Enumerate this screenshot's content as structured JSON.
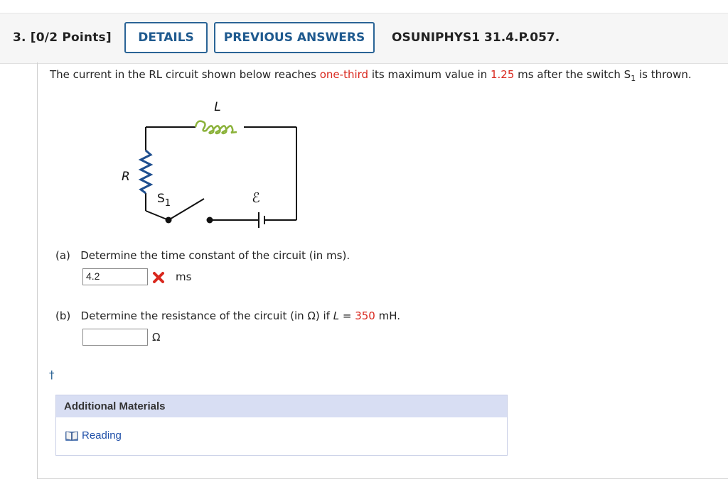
{
  "header": {
    "question_label": "3.  [0/2 Points]",
    "details_button": "DETAILS",
    "previous_answers_button": "PREVIOUS ANSWERS",
    "course_code": "OSUNIPHYS1 31.4.P.057."
  },
  "question": {
    "text_1": "The current in the RL circuit shown below reaches ",
    "fraction_highlight": "one-third",
    "text_2": " its maximum value in ",
    "time_value": "1.25",
    "text_3": " ms after the switch S",
    "switch_sub": "1",
    "text_4": " is thrown."
  },
  "circuit": {
    "inductor_label": "L",
    "resistor_label": "R",
    "switch_label": "S",
    "switch_sub": "1",
    "emf_label": "ℰ",
    "inductor_color": "#8bb23a",
    "resistor_color": "#1f4f8f"
  },
  "part_a": {
    "letter": "(a)",
    "prompt": "Determine the time constant of the circuit (in ms).",
    "answer_value": "4.2",
    "status": "incorrect",
    "status_icon": "x-icon",
    "unit": "ms"
  },
  "part_b": {
    "letter": "(b)",
    "prompt_1": "Determine the resistance of the circuit (in Ω) if ",
    "prompt_var": "L",
    "prompt_2": " = ",
    "inductance_value": "350",
    "prompt_3": " mH.",
    "answer_value": "",
    "unit": "Ω"
  },
  "footnote_mark": "†",
  "additional_materials": {
    "heading": "Additional Materials",
    "link_label": "Reading",
    "link_icon": "book-icon"
  },
  "colors": {
    "accent": "#1f5a8f",
    "highlight_red": "#d9281e",
    "materials_header_bg": "#d8def3"
  }
}
